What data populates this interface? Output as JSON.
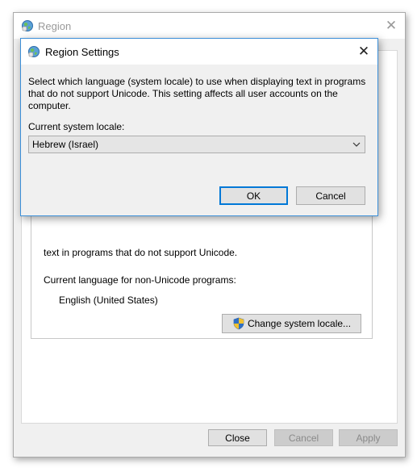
{
  "region_window": {
    "title": "Region",
    "close_glyph": "✕",
    "unicode_text_line1": "text in programs that do not support Unicode.",
    "current_language_label": "Current language for non-Unicode programs:",
    "current_language_value": "English (United States)",
    "change_locale_label": "Change system locale...",
    "footer": {
      "close_label": "Close",
      "cancel_label": "Cancel",
      "apply_label": "Apply"
    }
  },
  "settings_dialog": {
    "title": "Region Settings",
    "close_glyph": "✕",
    "description_lines": [
      "Select which language (system locale) to use when displaying text in programs",
      "that do not support Unicode. This setting affects all user accounts on the",
      "computer."
    ],
    "locale_label": "Current system locale:",
    "locale_value": "Hebrew (Israel)",
    "ok_label": "OK",
    "cancel_label": "Cancel"
  },
  "icons": {
    "window_icon": "globe-icon",
    "shield": "uac-shield-icon",
    "dropdown": "chevron-down-icon"
  },
  "colors": {
    "accent": "#0078d7",
    "dialog_border": "#3c8fd8",
    "window_bg": "#f0f0f0",
    "button_bg": "#e1e1e1"
  }
}
